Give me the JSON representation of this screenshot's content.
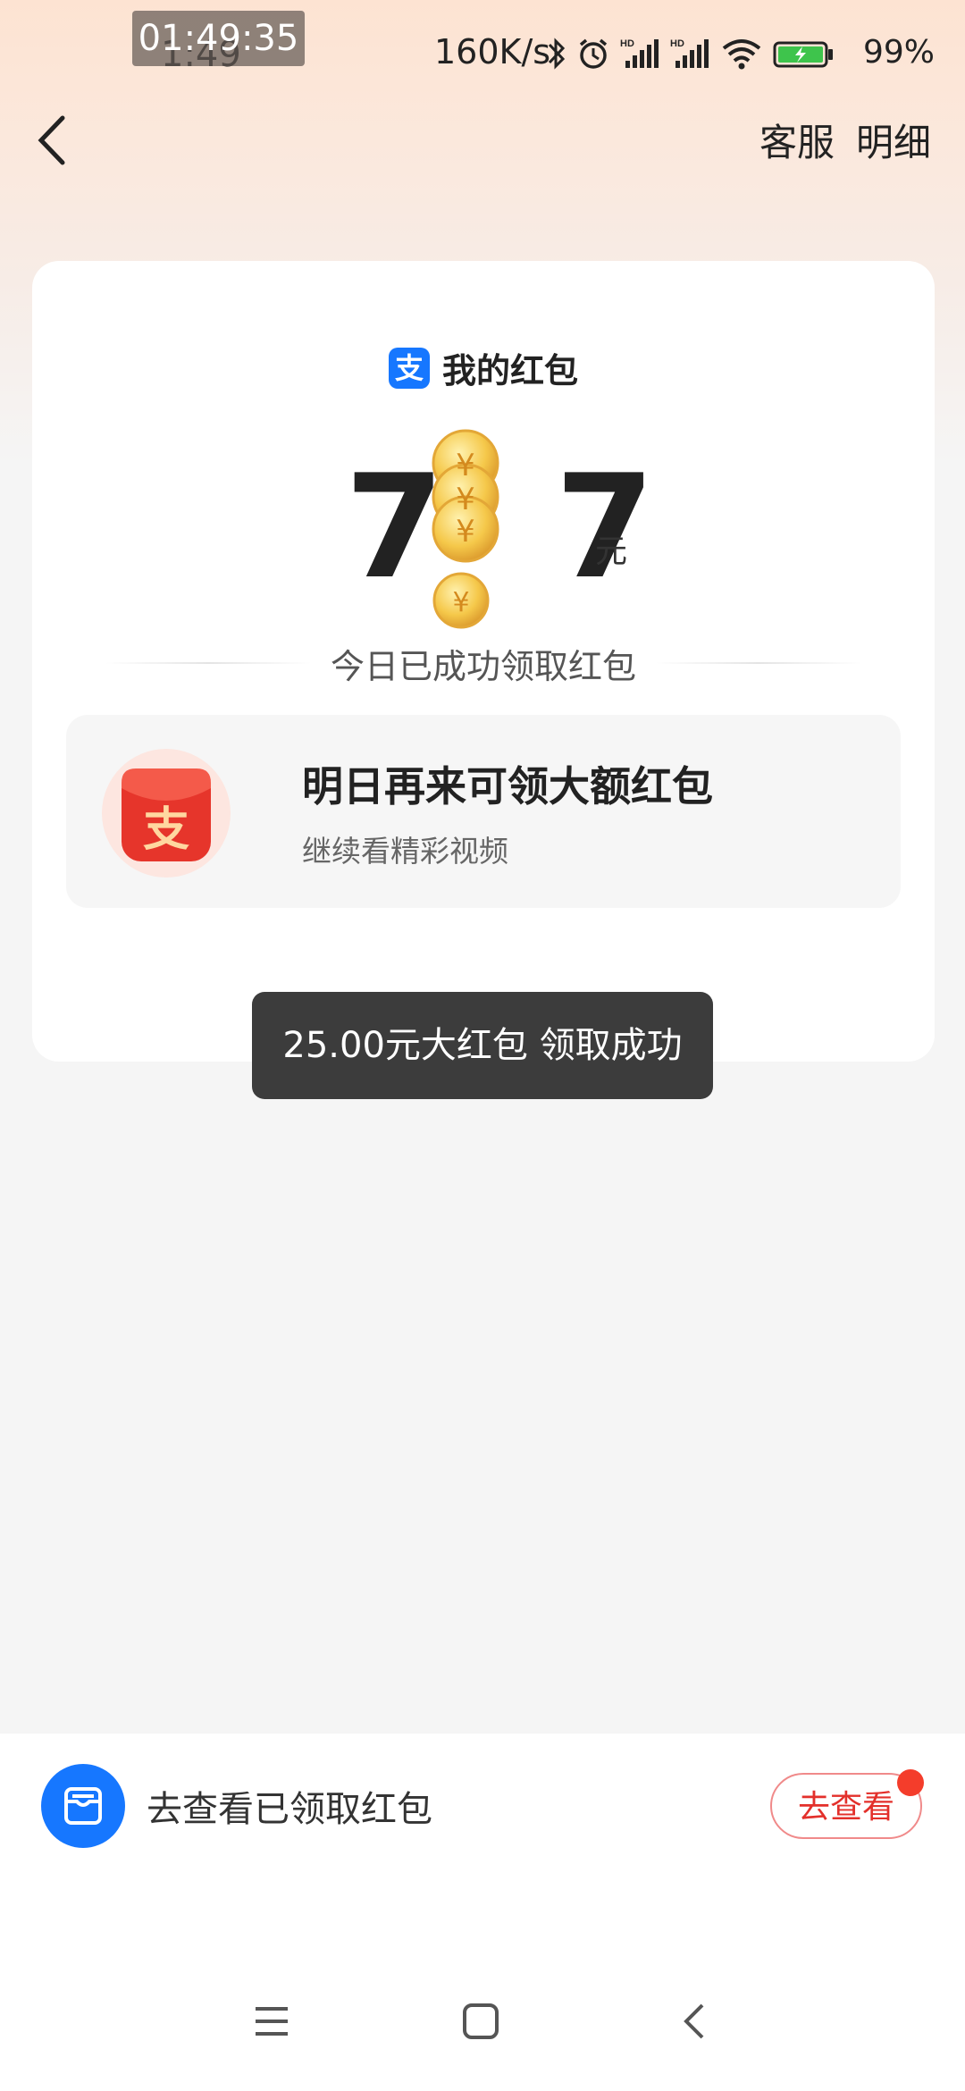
{
  "status_bar": {
    "recording_time": "01:49:35",
    "clock": "1:49",
    "net_speed": "160K/s",
    "battery": "99%"
  },
  "nav": {
    "customer_service": "客服",
    "details": "明细"
  },
  "card": {
    "brand_icon_text": "支",
    "title": "我的红包",
    "amount": "7",
    "amount_tail": "7",
    "unit": "元",
    "today_text": "今日已成功领取红包"
  },
  "promo": {
    "icon_text": "支",
    "title": "明日再来可领大额红包",
    "subtitle": "继续看精彩视频"
  },
  "toast": {
    "text": "25.00元大红包 领取成功"
  },
  "bottom": {
    "text": "去查看已领取红包",
    "button": "去查看"
  },
  "colors": {
    "accent_blue": "#1677ff",
    "accent_red": "#e3302b",
    "toast_bg": "#3c3c3c"
  }
}
